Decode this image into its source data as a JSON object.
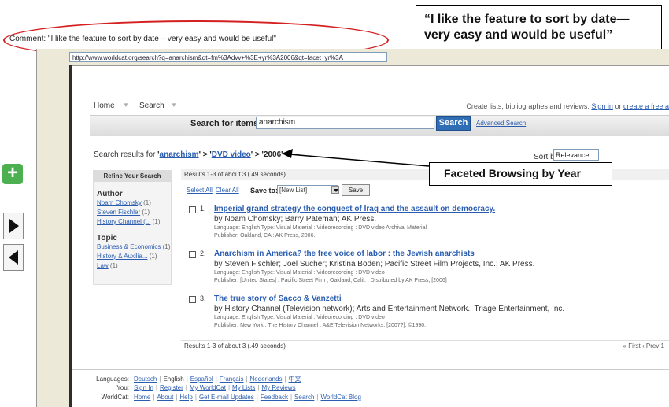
{
  "annotations": {
    "comment_label": "Comment: \"I like the feature to sort by date – very easy and would be useful\"",
    "quote_callout": "“I like the feature to sort by date—very easy and would be useful”",
    "facet_callout": "Faceted Browsing by Year",
    "ellipse_color": "#d42020"
  },
  "side_nav": {
    "add_icon": "plus-icon",
    "next_icon": "play-right-icon",
    "prev_icon": "play-left-icon"
  },
  "browser": {
    "url": "http://www.worldcat.org/search?q=anarchism&qt=fm%3Advv+%3E+yr%3A2006&qt=facet_yr%3A"
  },
  "page": {
    "nav": {
      "home": "Home",
      "search": "Search",
      "create_text": "Create lists, bibliographes and reviews: ",
      "sign_in": "Sign in",
      "or": " or ",
      "create_free": "create a free a"
    },
    "search": {
      "label": "Search for items:",
      "value": "anarchism",
      "button": "Search",
      "advanced": "Advanced Search"
    },
    "breadcrumb": {
      "prefix": "Search results for ",
      "term": "anarchism",
      "sep1": "' > '",
      "format": "DVD video",
      "sep2": "' > ",
      "year": "'2006'",
      "open_quote": "'"
    },
    "sort": {
      "label": "Sort by",
      "value": "Relevance"
    },
    "refine": {
      "header": "Refine Your Search",
      "author_title": "Author",
      "authors": [
        {
          "name": "Noam Chomsky",
          "count": "(1)"
        },
        {
          "name": "Steven Fischler",
          "count": "(1)"
        },
        {
          "name": "History Channel (...",
          "count": "(1)"
        }
      ],
      "topic_title": "Topic",
      "topics": [
        {
          "name": "Business & Economics",
          "count": "(1)"
        },
        {
          "name": "History & Auxilia...",
          "count": "(1)"
        },
        {
          "name": "Law",
          "count": "(1)"
        }
      ]
    },
    "results_bar": "Results 1-3 of about 3 (.49 seconds)",
    "tools": {
      "select_all": "Select All",
      "clear_all": "Clear All",
      "save_to": "Save to:",
      "list_value": "[New List]",
      "save_button": "Save"
    },
    "results": [
      {
        "num": "1.",
        "title": "Imperial grand strategy the conquest of Iraq and the assault on democracy.",
        "author": "by Noam Chomsky; Barry Pateman; AK Press.",
        "meta": "Language: English  Type:  Visual Material : Videorecording :  DVD video  Archival Material",
        "pub": "Publisher: Oakland, CA : AK Press, 2006."
      },
      {
        "num": "2.",
        "title": "Anarchism in America? the free voice of labor : the Jewish anarchists",
        "author": "by Steven Fischler; Joel Sucher; Kristina Boden; Pacific Street Film Projects, Inc.; AK Press.",
        "meta": "Language: English  Type:  Visual Material : Videorecording :  DVD video",
        "pub": "Publisher: [United States] : Pacific Street Film ; Oakland, Calif. : Distributed by AK Press, [2006]"
      },
      {
        "num": "3.",
        "title": "The true story of Sacco & Vanzetti",
        "author": "by History Channel (Television network); Arts and Entertainment Network.; Triage Entertainment, Inc.",
        "meta": "Language: English  Type:  Visual Material : Videorecording :  DVD video",
        "pub": "Publisher: New York : The History Channel : A&E Television Networks, [2007?], ©1990."
      }
    ],
    "results_foot": "Results 1-3 of about 3 (.49 seconds)",
    "pager": "« First  ‹ Prev  1",
    "footer": {
      "languages_label": "Languages:",
      "languages": [
        "Deutsch",
        "English",
        "Español",
        "Français",
        "Nederlands",
        "中文"
      ],
      "you_label": "You:",
      "you_links": [
        "Sign In",
        "Register",
        "My WorldCat",
        "My Lists",
        "My Reviews"
      ],
      "worldcat_label": "WorldCat:",
      "worldcat_links": [
        "Home",
        "About",
        "Help",
        "Get E-mail Updates",
        "Feedback",
        "Search",
        "WorldCat Blog"
      ]
    }
  }
}
